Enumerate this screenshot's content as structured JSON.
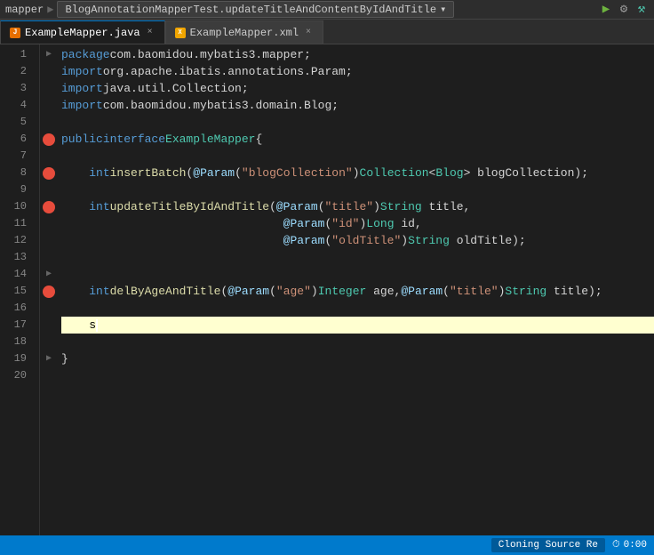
{
  "topbar": {
    "left_text": "mapper",
    "tab_label": "BlogAnnotationMapperTest.updateTitleAndContentByIdAndTitle",
    "icons": {
      "run": "▶",
      "settings": "⚙",
      "build": "🔨"
    }
  },
  "tabs": [
    {
      "id": "java",
      "label": "ExampleMapper.java",
      "icon_type": "java",
      "active": true
    },
    {
      "id": "xml",
      "label": "ExampleMapper.xml",
      "icon_type": "xml",
      "active": false
    }
  ],
  "lines": [
    {
      "num": 1,
      "has_arrow": true,
      "has_mybatis": false,
      "hl": false,
      "content": "package com.baomidou.mybatis3.mapper;"
    },
    {
      "num": 2,
      "has_arrow": false,
      "has_mybatis": false,
      "hl": false,
      "content": "import org.apache.ibatis.annotations.Param;"
    },
    {
      "num": 3,
      "has_arrow": false,
      "has_mybatis": false,
      "hl": false,
      "content": "import java.util.Collection;"
    },
    {
      "num": 4,
      "has_arrow": false,
      "has_mybatis": false,
      "hl": false,
      "content": "import com.baomidou.mybatis3.domain.Blog;"
    },
    {
      "num": 5,
      "has_arrow": false,
      "has_mybatis": false,
      "hl": false,
      "content": ""
    },
    {
      "num": 6,
      "has_arrow": false,
      "has_mybatis": true,
      "hl": false,
      "content": "public interface ExampleMapper  {"
    },
    {
      "num": 7,
      "has_arrow": false,
      "has_mybatis": false,
      "hl": false,
      "content": ""
    },
    {
      "num": 8,
      "has_arrow": false,
      "has_mybatis": true,
      "hl": false,
      "content": "    int insertBatch(@Param(\"blogCollection\") Collection<Blog> blogCollection);"
    },
    {
      "num": 9,
      "has_arrow": false,
      "has_mybatis": false,
      "hl": false,
      "content": ""
    },
    {
      "num": 10,
      "has_arrow": false,
      "has_mybatis": true,
      "hl": false,
      "content": "    int updateTitleByIdAndTitle(@Param(\"title\") String title,"
    },
    {
      "num": 11,
      "has_arrow": false,
      "has_mybatis": false,
      "hl": false,
      "content": "                                @Param(\"id\") Long id,"
    },
    {
      "num": 12,
      "has_arrow": false,
      "has_mybatis": false,
      "hl": false,
      "content": "                                @Param(\"oldTitle\") String oldTitle);"
    },
    {
      "num": 13,
      "has_arrow": false,
      "has_mybatis": false,
      "hl": false,
      "content": ""
    },
    {
      "num": 14,
      "has_arrow": true,
      "has_mybatis": false,
      "hl": false,
      "content": ""
    },
    {
      "num": 15,
      "has_arrow": false,
      "has_mybatis": true,
      "hl": false,
      "content": "    int delByAgeAndTitle(@Param(\"age\") Integer age, @Param(\"title\") String title);"
    },
    {
      "num": 16,
      "has_arrow": false,
      "has_mybatis": false,
      "hl": false,
      "content": ""
    },
    {
      "num": 17,
      "has_arrow": false,
      "has_mybatis": false,
      "hl": true,
      "content": "    s"
    },
    {
      "num": 18,
      "has_arrow": false,
      "has_mybatis": false,
      "hl": false,
      "content": ""
    },
    {
      "num": 19,
      "has_arrow": true,
      "has_mybatis": false,
      "hl": false,
      "content": "}"
    },
    {
      "num": 20,
      "has_arrow": false,
      "has_mybatis": false,
      "hl": false,
      "content": ""
    }
  ],
  "statusbar": {
    "cloning_label": "Cloning Source Re",
    "time_label": "0:00",
    "clock_icon": "⏱"
  }
}
